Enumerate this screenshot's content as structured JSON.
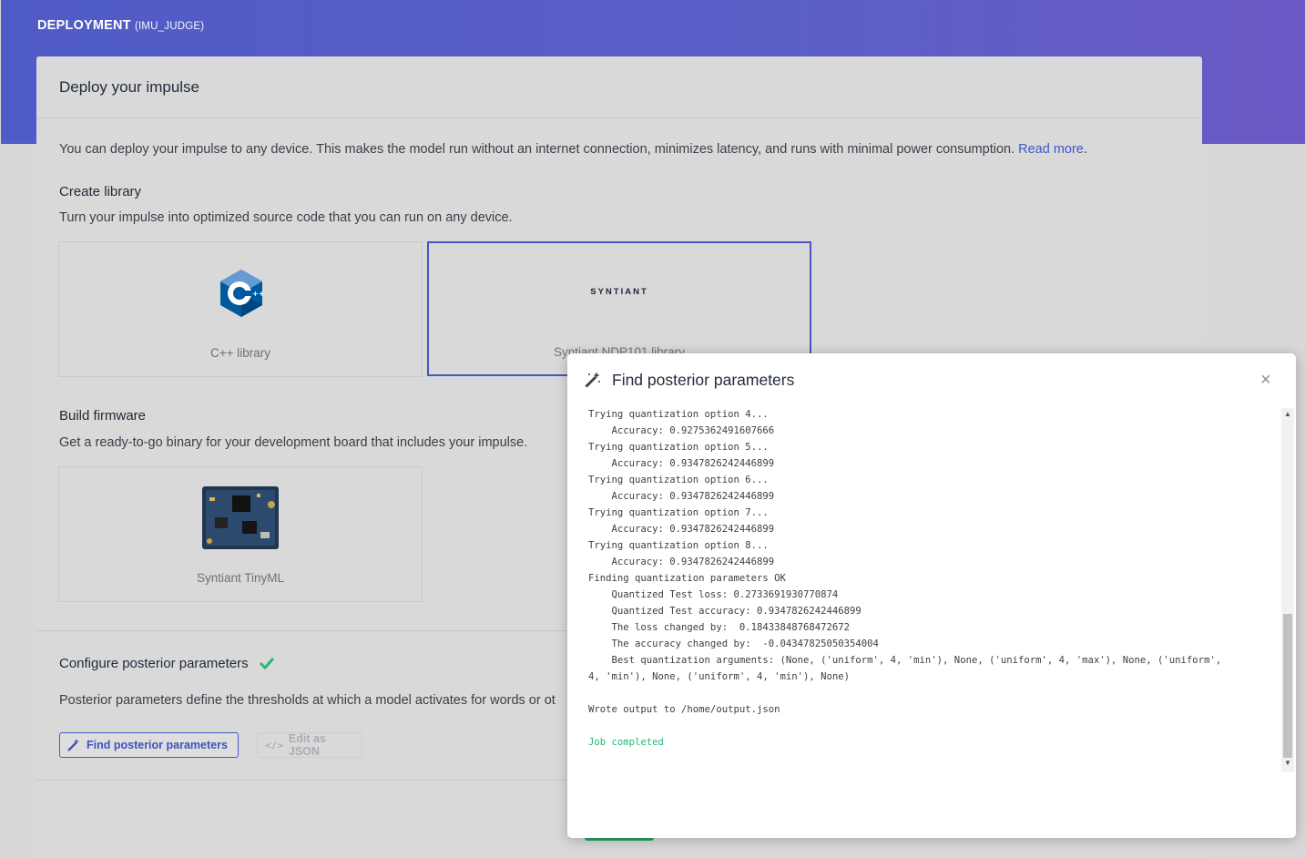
{
  "header": {
    "title": "DEPLOYMENT",
    "project": "(IMU_JUDGE)"
  },
  "card": {
    "title": "Deploy your impulse",
    "intro": "You can deploy your impulse to any device. This makes the model run without an internet connection, minimizes latency, and runs with minimal power consumption.",
    "read_more": "Read more",
    "read_more_suffix": "."
  },
  "create_library": {
    "heading": "Create library",
    "description": "Turn your impulse into optimized source code that you can run on any device.",
    "tiles": [
      {
        "label": "C++ library",
        "icon": "cpp-logo-icon"
      },
      {
        "label": "Syntiant NDP101 library",
        "logo_text": "SYNTIANT",
        "selected": true
      }
    ]
  },
  "build_firmware": {
    "heading": "Build firmware",
    "description": "Get a ready-to-go binary for your development board that includes your impulse.",
    "tiles": [
      {
        "label": "Syntiant TinyML",
        "icon": "dev-board-icon"
      }
    ]
  },
  "posterior": {
    "heading": "Configure posterior parameters",
    "description": "Posterior parameters define the thresholds at which a model activates for words or ot",
    "find_button": "Find posterior parameters",
    "edit_button": "Edit as JSON"
  },
  "modal": {
    "title": "Find posterior parameters",
    "close": "×",
    "log": [
      "Trying quantization option 4...",
      "    Accuracy: 0.9275362491607666",
      "Trying quantization option 5...",
      "    Accuracy: 0.9347826242446899",
      "Trying quantization option 6...",
      "    Accuracy: 0.9347826242446899",
      "Trying quantization option 7...",
      "    Accuracy: 0.9347826242446899",
      "Trying quantization option 8...",
      "    Accuracy: 0.9347826242446899",
      "Finding quantization parameters OK",
      "    Quantized Test loss: 0.2733691930770874",
      "    Quantized Test accuracy: 0.9347826242446899",
      "    The loss changed by:  0.18433848768472672",
      "    The accuracy changed by:  -0.04347825050354004",
      "    Best quantization arguments: (None, ('uniform', 4, 'min'), None, ('uniform', 4, 'max'), None, ('uniform',",
      "4, 'min'), None, ('uniform', 4, 'min'), None)",
      "",
      "Wrote output to /home/output.json",
      "",
      "Job completed"
    ],
    "log_status_color": "#2bb673"
  },
  "colors": {
    "accent": "#4b59c6",
    "success": "#2bb673",
    "hero_start": "#4f5bc7",
    "hero_end": "#6b59c4"
  }
}
